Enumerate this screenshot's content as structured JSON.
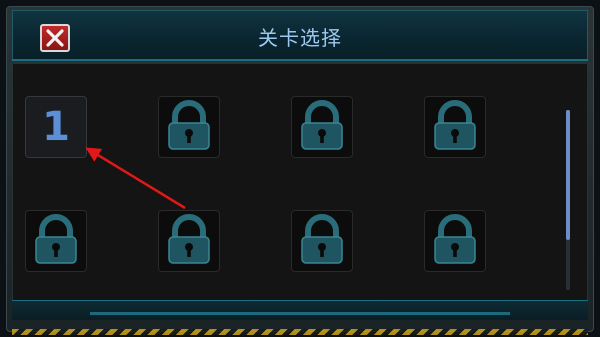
{
  "title": "关卡选择",
  "close_label": "X",
  "levels": [
    {
      "label": "1",
      "state": "unlocked"
    },
    {
      "label": "",
      "state": "locked"
    },
    {
      "label": "",
      "state": "locked"
    },
    {
      "label": "",
      "state": "locked"
    },
    {
      "label": "",
      "state": "locked"
    },
    {
      "label": "",
      "state": "locked"
    },
    {
      "label": "",
      "state": "locked"
    },
    {
      "label": "",
      "state": "locked"
    }
  ],
  "colors": {
    "accent": "#9ec9ee",
    "level_number": "#5e8fd6",
    "lock": "#1f5560",
    "close": "#c02a2a",
    "annotation_arrow": "#e01818"
  },
  "icons": {
    "close": "close-icon",
    "lock": "lock-icon",
    "annotation": "arrow-annotation"
  }
}
